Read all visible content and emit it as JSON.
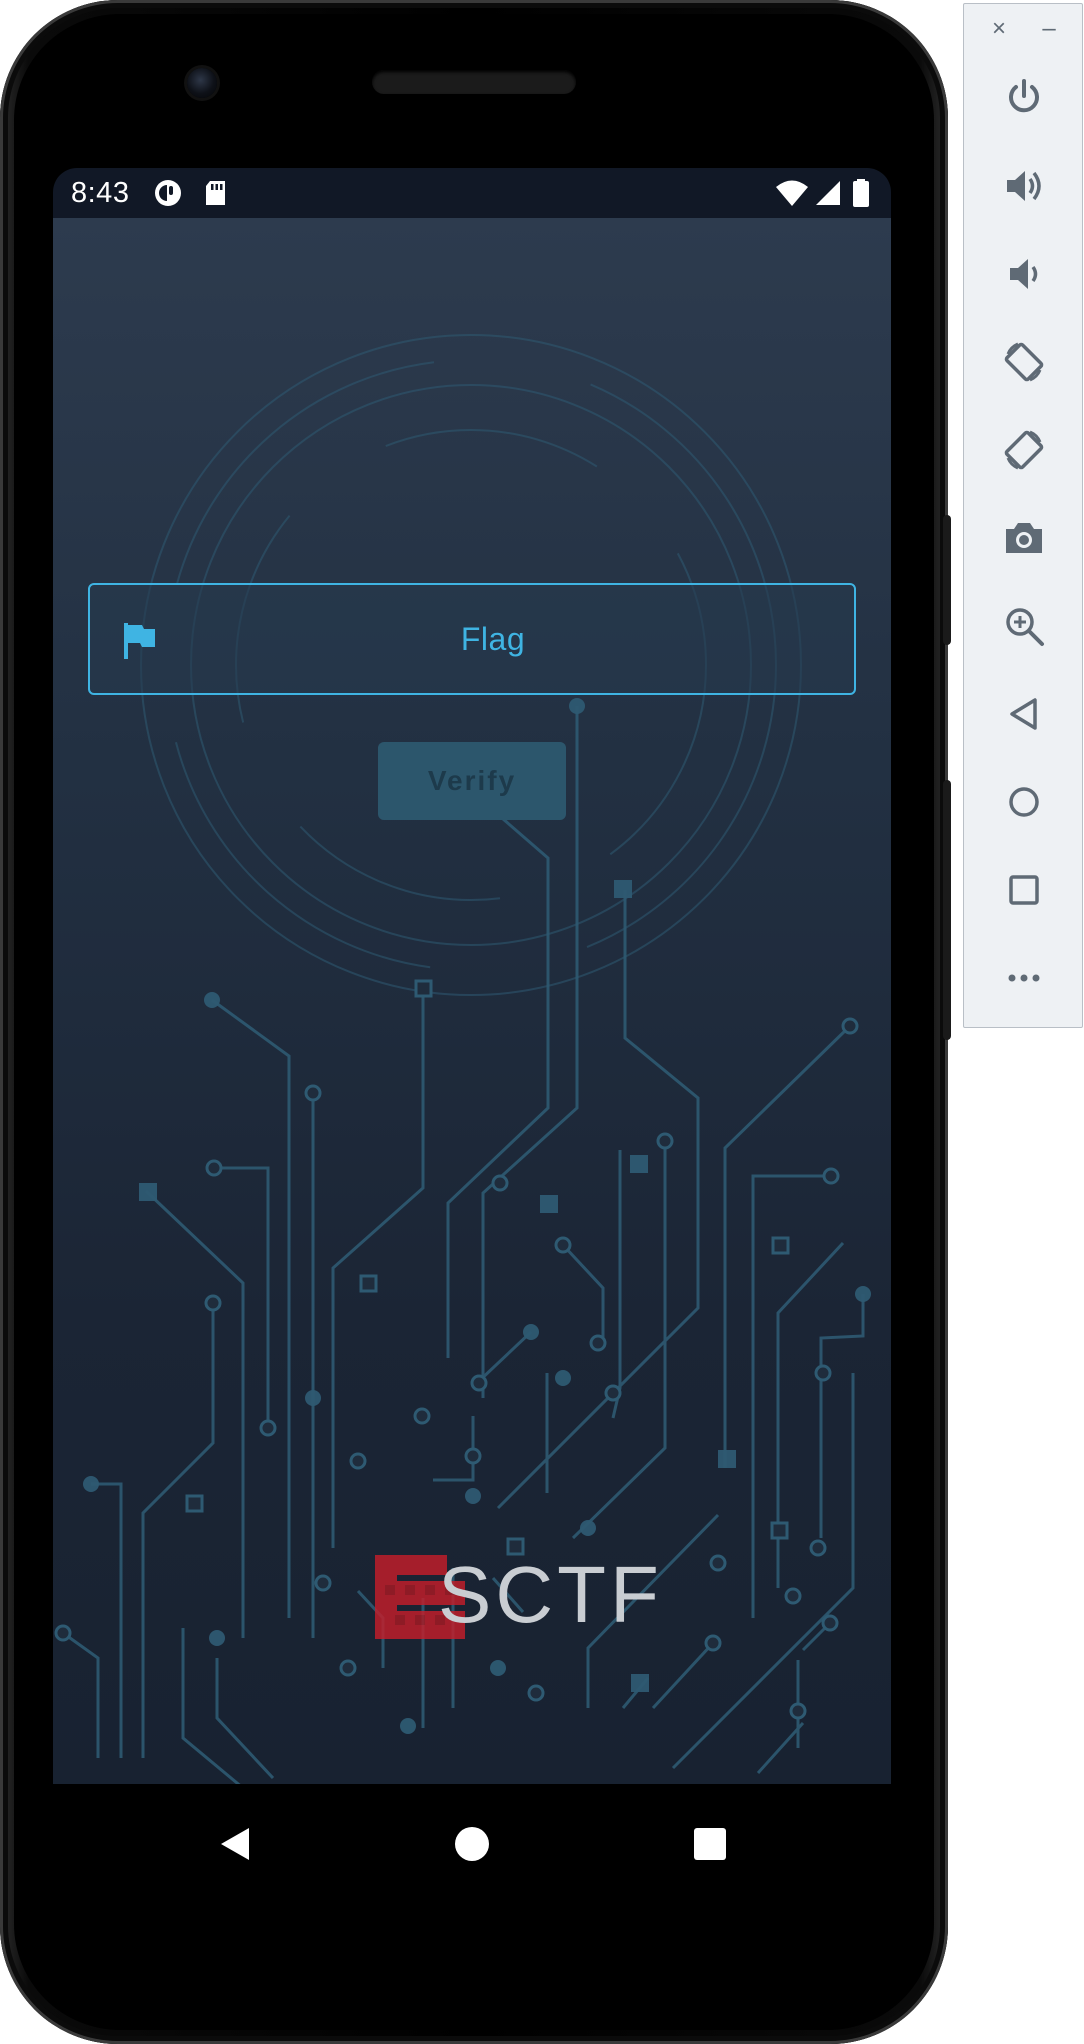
{
  "status_bar": {
    "time": "8:43",
    "left_icons": [
      "notification-app-icon",
      "sd-card-icon"
    ],
    "right_icons": [
      "wifi-icon",
      "cell-signal-icon",
      "battery-icon"
    ]
  },
  "app": {
    "flag_field": {
      "placeholder": "Flag",
      "icon": "flag-icon",
      "value": ""
    },
    "verify_button": {
      "label": "Verify",
      "enabled": false
    },
    "logo_text": "SCTF"
  },
  "colors": {
    "accent": "#3fb4e3",
    "background_top": "#2d3b4e",
    "background_bottom": "#182231",
    "circuit_lines": "#2e5a72",
    "logo_red": "#c81e2a",
    "button_disabled": "#2c566c"
  },
  "nav_bar": {
    "buttons": [
      "back-icon",
      "home-icon",
      "recents-icon"
    ]
  },
  "emulator_panel": {
    "close_label": "×",
    "minimize_label": "–",
    "buttons": [
      "power-icon",
      "volume-up-icon",
      "volume-down-icon",
      "rotate-left-icon",
      "rotate-right-icon",
      "camera-icon",
      "zoom-icon",
      "back-icon",
      "home-icon",
      "overview-icon",
      "more-icon"
    ]
  }
}
